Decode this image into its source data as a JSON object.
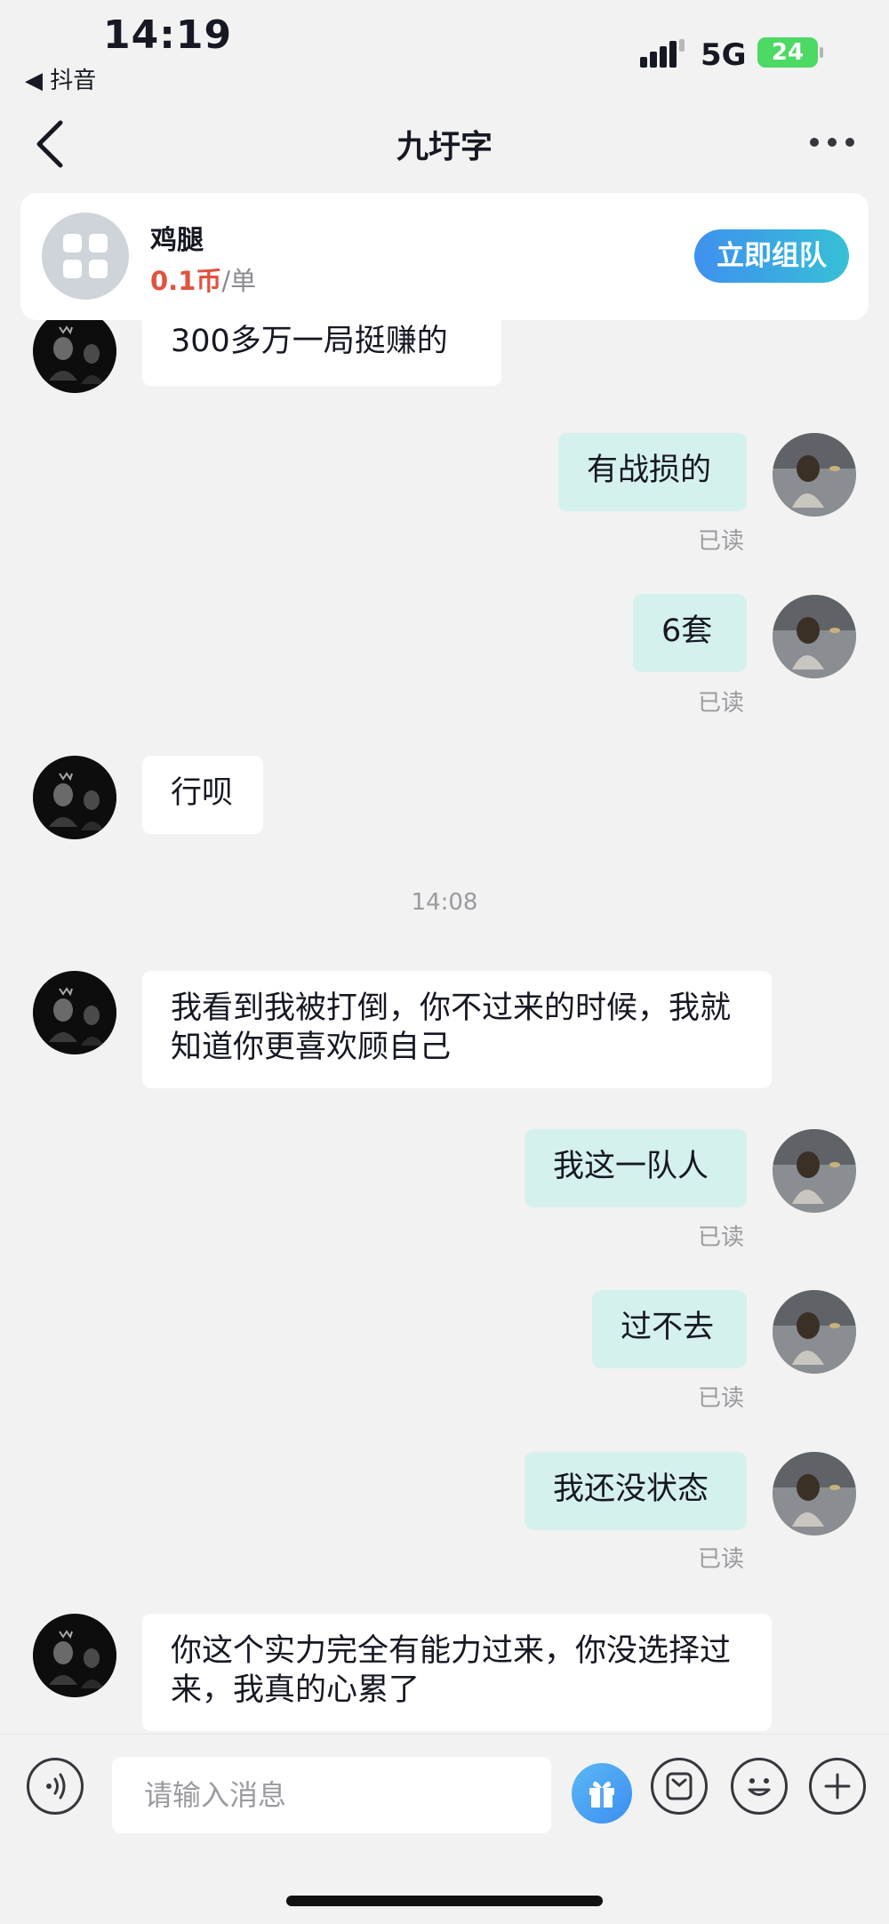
{
  "status_bar": {
    "time": "14:19",
    "back_app": "◀ 抖音",
    "network": "5G",
    "battery": "24"
  },
  "nav": {
    "title": "九圩字"
  },
  "product": {
    "name": "鸡腿",
    "price_amount": "0.1币",
    "price_unit": "/单",
    "join_label": "立即组队"
  },
  "messages": [
    {
      "from": "them",
      "text": "300多万一局挺赚的"
    },
    {
      "from": "me",
      "text": "有战损的",
      "status": "已读"
    },
    {
      "from": "me",
      "text": "6套",
      "status": "已读"
    },
    {
      "from": "them",
      "text": "行呗"
    },
    {
      "from": "them",
      "text": "我看到我被打倒，你不过来的时候，我就知道你更喜欢顾自己"
    },
    {
      "from": "me",
      "text": "我这一队人",
      "status": "已读"
    },
    {
      "from": "me",
      "text": "过不去",
      "status": "已读"
    },
    {
      "from": "me",
      "text": "我还没状态",
      "status": "已读"
    },
    {
      "from": "them",
      "text": "你这个实力完全有能力过来，你没选择过来，我真的心累了"
    }
  ],
  "time_divider": "14:08",
  "input": {
    "placeholder": "请输入消息",
    "value": ""
  },
  "icons": {
    "voice": "voice-icon",
    "gift": "gift-icon",
    "sticker": "sticker-icon",
    "emoji": "emoji-icon",
    "plus": "plus-icon"
  },
  "colors": {
    "outgoing_bubble": "#d5f1ed",
    "incoming_bubble": "#ffffff",
    "price": "#e0533e",
    "join_button_start": "#3f90ef",
    "join_button_end": "#36c0d6",
    "battery": "#4cd964"
  }
}
